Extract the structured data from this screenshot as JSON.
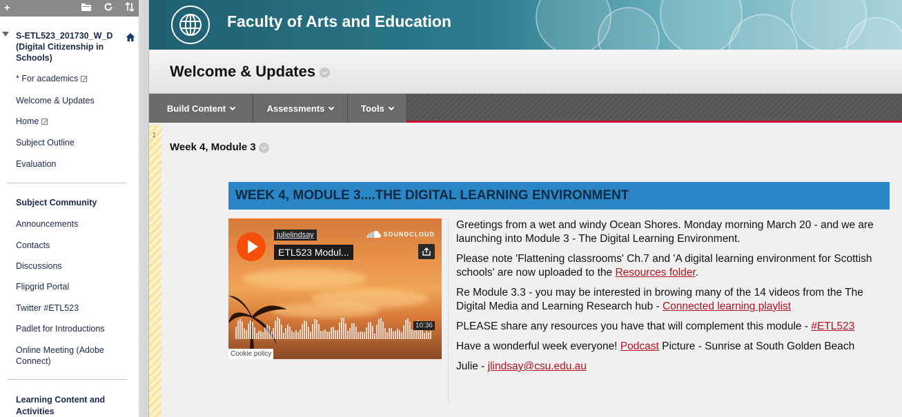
{
  "sidebar": {
    "toolbar_add": "+",
    "course_title": "S-ETL523_201730_W_D (Digital Citizenship in Schools)",
    "items": [
      {
        "label": "* For academics"
      },
      {
        "label": "Welcome & Updates"
      },
      {
        "label": "Home"
      },
      {
        "label": "Subject Outline"
      },
      {
        "label": "Evaluation"
      }
    ],
    "community_heading": "Subject Community",
    "community_items": [
      {
        "label": "Announcements"
      },
      {
        "label": "Contacts"
      },
      {
        "label": "Discussions"
      },
      {
        "label": "Flipgrid Portal"
      },
      {
        "label": "Twitter #ETL523"
      },
      {
        "label": "Padlet for Introductions"
      },
      {
        "label": "Online Meeting (Adobe Connect)"
      }
    ],
    "learning_heading": "Learning Content and Activities"
  },
  "banner": {
    "title": "Faculty of Arts and Education"
  },
  "page": {
    "title": "Welcome & Updates"
  },
  "action_bar": {
    "build_content": "Build Content",
    "assessments": "Assessments",
    "tools": "Tools"
  },
  "content": {
    "item_title": "Week 4, Module 3",
    "module_heading": "WEEK 4, MODULE 3....THE DIGITAL LEARNING ENVIRONMENT",
    "player": {
      "username": "julielindsay",
      "track": "ETL523 Modul...",
      "brand": "SOUNDCLOUD",
      "duration": "10:36",
      "cookie": "Cookie policy"
    },
    "paragraphs": {
      "p1": "Greetings from a wet and windy Ocean Shores. Monday morning March 20 - and we are launching into Module 3 - The Digital Learning Environment.",
      "p2_text": "Please note 'Flattening classrooms' Ch.7 and 'A digital learning environment for Scottish schools' are now uploaded to the ",
      "p2_link": "Resources folder",
      "p2_end": ".",
      "p3_text": "Re Module 3.3 - you may be interested in browing many of the 14 videos from the The Digital Media and Learning Research hub - ",
      "p3_link": "Connected learning playlist",
      "p4_text": "PLEASE share any resources you have that will complement this module - ",
      "p4_link": "#ETL523",
      "p5_text": "Have a wonderful week everyone! ",
      "p5_link": "Podcast",
      "p5_end": " Picture - Sunrise at South Golden Beach",
      "p6_text": "Julie - ",
      "p6_link": "jlindsay@csu.edu.au"
    }
  },
  "colors": {
    "accent_red": "#c8102e",
    "heading_blue": "#2a86c5",
    "link_red": "#b3121f"
  }
}
